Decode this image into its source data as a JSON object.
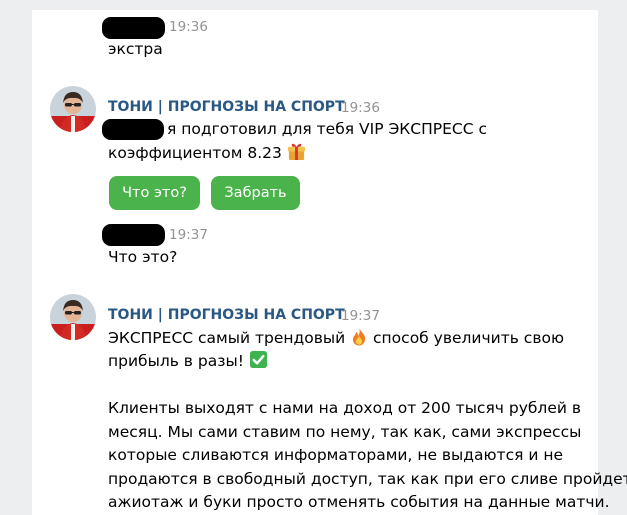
{
  "messages": [
    {
      "time": "19:36",
      "text": "экстра"
    },
    {
      "author": "ТОНИ | ПРОГНОЗЫ НА СПОРТ",
      "time": "19:36",
      "text_line1": "я подготовил для тебя VIP ЭКСПРЕСС с",
      "text_line2": "коэффициентом 8.23",
      "buttons": [
        "Что это?",
        "Забрать"
      ]
    },
    {
      "time": "19:37",
      "text": "Что это?"
    },
    {
      "author": "ТОНИ | ПРОГНОЗЫ НА СПОРТ",
      "time": "19:37",
      "line1a": "ЭКСПРЕСС самый трендовый",
      "line1b": "способ увеличить свою",
      "line2": "прибыль в разы!",
      "para_lines": [
        "Клиенты выходят с нами на доход от 200 тысяч рублей в",
        "месяц. Мы сами ставим по нему, так как, сами экспрессы",
        "которые сливаются информаторами, не выдаются и не",
        "продаются в свободный доступ, так как при его сливе пройдет",
        "ажиотаж и буки просто отменять события на данные матчи."
      ]
    }
  ],
  "icons": {
    "gift": "gift-emoji",
    "fire": "fire-emoji",
    "check": "check-mark-emoji"
  },
  "colors": {
    "author": "#2a5885",
    "button": "#4bb34b",
    "time": "#939393"
  }
}
